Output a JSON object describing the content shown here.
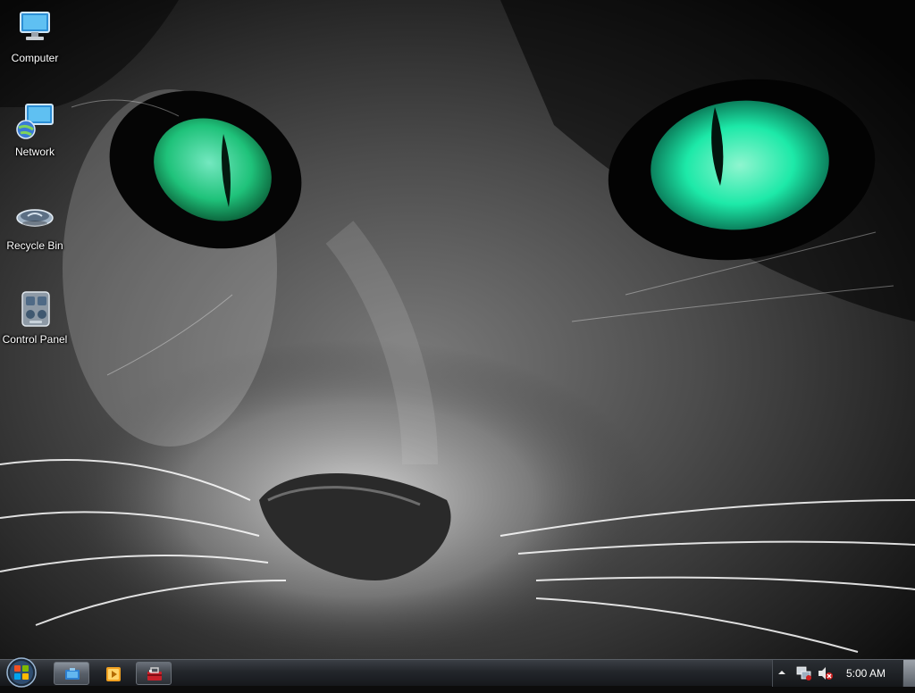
{
  "desktop": {
    "icons": [
      {
        "label": "Computer",
        "icon": "computer-icon"
      },
      {
        "label": "Network",
        "icon": "network-icon"
      },
      {
        "label": "Recycle Bin",
        "icon": "recycle-bin-icon"
      },
      {
        "label": "Control Panel",
        "icon": "control-panel-icon"
      }
    ]
  },
  "taskbar": {
    "pinned": [
      {
        "icon": "windows-explorer-icon"
      },
      {
        "icon": "media-player-icon"
      },
      {
        "icon": "toolbox-icon"
      }
    ],
    "tray": {
      "clock": "5:00 AM",
      "icons": [
        "show-hidden-icons-arrow",
        "network-tray-icon",
        "volume-muted-icon"
      ]
    }
  },
  "colors": {
    "taskbar": "#23262b",
    "eye_green": "#1de9a8"
  }
}
